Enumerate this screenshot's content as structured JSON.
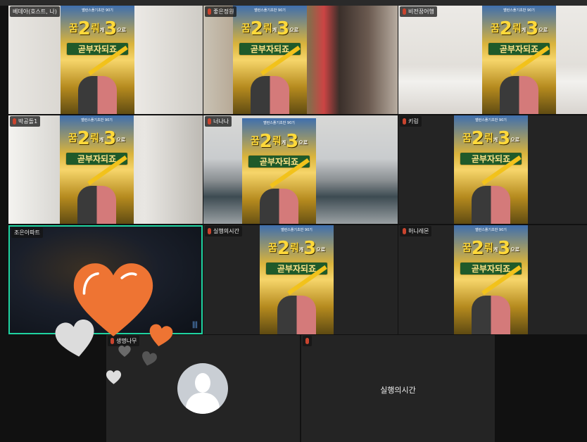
{
  "poster": {
    "title": "밸런스플기초반 90기",
    "w1": "꿈",
    "n1": "2",
    "w2": "뤄",
    "w3": "개",
    "n2": "3",
    "w4": "으로",
    "sub": "곧부자되죠"
  },
  "participants": [
    {
      "name": "베데아(호스트, 나)",
      "mic": false
    },
    {
      "name": "좋은정원",
      "mic": true
    },
    {
      "name": "비전꿈어행",
      "mic": true
    },
    {
      "name": "박공돌1",
      "mic": true
    },
    {
      "name": "너나나",
      "mic": true
    },
    {
      "name": "키링",
      "mic": true
    },
    {
      "name": "조은아파트",
      "mic": false,
      "active": true
    },
    {
      "name": "실행의시간",
      "mic": true
    },
    {
      "name": "허니레몬",
      "mic": true
    },
    {
      "name": "생명나무",
      "mic": true
    },
    {
      "name": "",
      "mic": true,
      "display_text": "실행의시간"
    }
  ],
  "colors": {
    "active_border": "#1fd3a0",
    "heart": "#ee7433"
  }
}
